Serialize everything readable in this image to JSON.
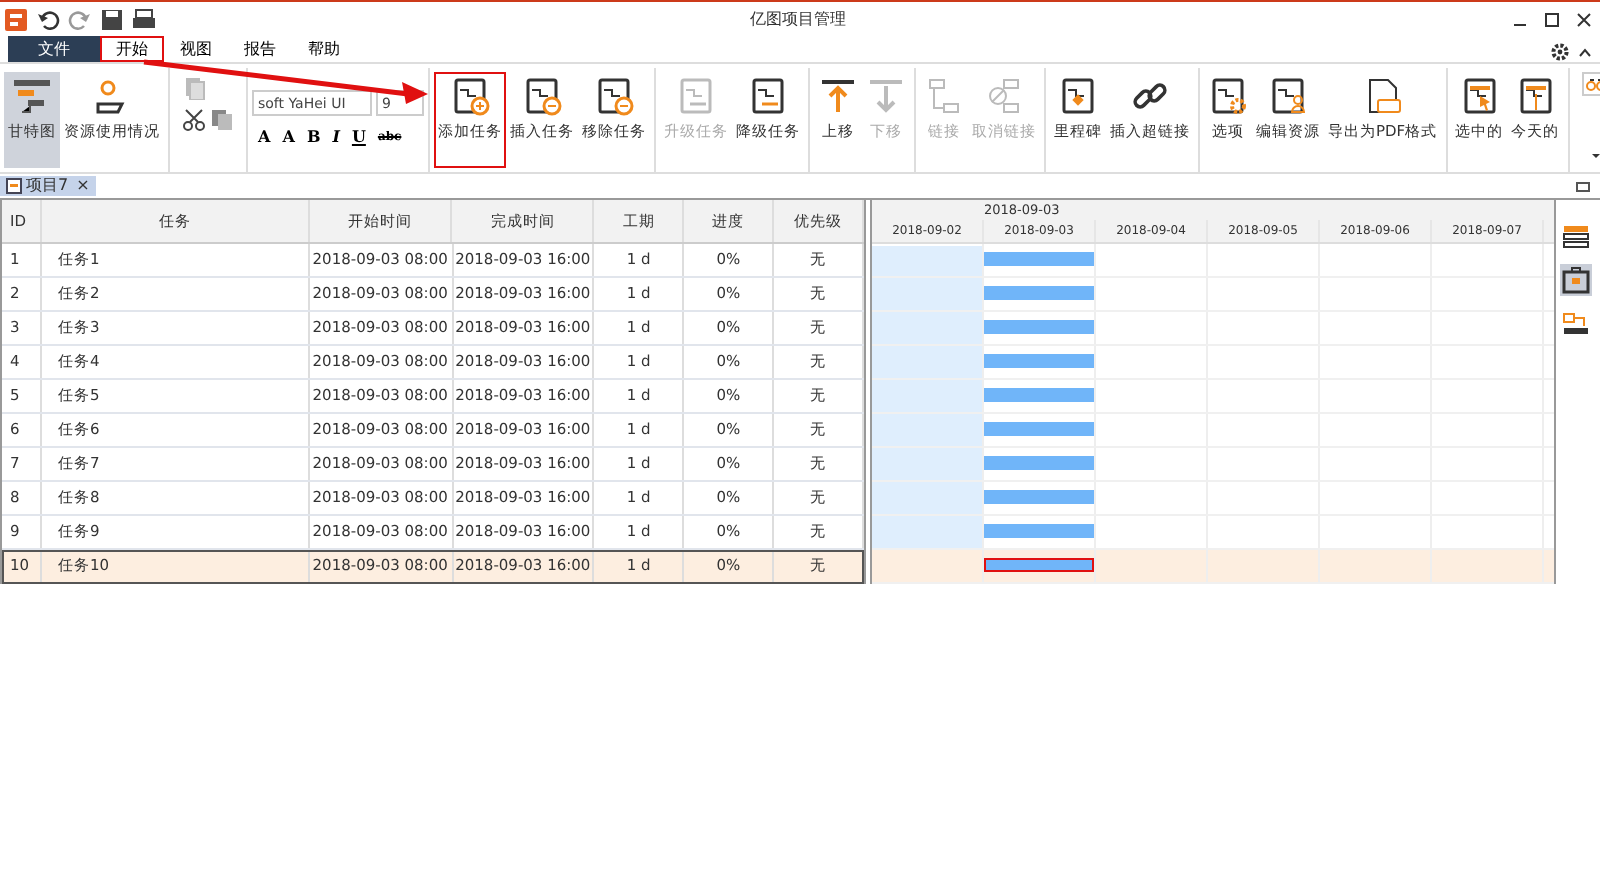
{
  "window": {
    "title": "亿图项目管理"
  },
  "menu_tabs": [
    {
      "label": "文件",
      "kind": "file",
      "selected": false,
      "highlighted": false
    },
    {
      "label": "开始",
      "kind": "tab",
      "selected": true,
      "highlighted": true
    },
    {
      "label": "视图",
      "kind": "tab",
      "selected": false,
      "highlighted": false
    },
    {
      "label": "报告",
      "kind": "tab",
      "selected": false,
      "highlighted": false
    },
    {
      "label": "帮助",
      "kind": "tab",
      "selected": false,
      "highlighted": false
    }
  ],
  "ribbon": [
    {
      "kind": "buttons",
      "items": [
        {
          "label": "甘特图",
          "selected": true,
          "disabled": false,
          "highlighted": false
        },
        {
          "label": "资源使用情况",
          "selected": false,
          "disabled": false,
          "highlighted": false
        }
      ]
    },
    {
      "kind": "clipboard"
    },
    {
      "kind": "font",
      "font": "soft YaHei UI",
      "size": "9",
      "styles": [
        "A",
        "A",
        "B",
        "I",
        "U",
        "abc"
      ]
    },
    {
      "kind": "buttons",
      "items": [
        {
          "label": "添加任务",
          "selected": false,
          "disabled": false,
          "highlighted": true
        },
        {
          "label": "插入任务",
          "selected": false,
          "disabled": false,
          "highlighted": false
        },
        {
          "label": "移除任务",
          "selected": false,
          "disabled": false,
          "highlighted": false
        }
      ]
    },
    {
      "kind": "buttons",
      "items": [
        {
          "label": "升级任务",
          "selected": false,
          "disabled": true,
          "highlighted": false
        },
        {
          "label": "降级任务",
          "selected": false,
          "disabled": false,
          "highlighted": false
        }
      ]
    },
    {
      "kind": "buttons",
      "items": [
        {
          "label": "上移",
          "selected": false,
          "disabled": false,
          "highlighted": false
        },
        {
          "label": "下移",
          "selected": false,
          "disabled": true,
          "highlighted": false
        }
      ]
    },
    {
      "kind": "buttons",
      "items": [
        {
          "label": "链接",
          "selected": false,
          "disabled": true,
          "highlighted": false
        },
        {
          "label": "取消链接",
          "selected": false,
          "disabled": true,
          "highlighted": false
        }
      ]
    },
    {
      "kind": "buttons",
      "items": [
        {
          "label": "里程碑",
          "selected": false,
          "disabled": false,
          "highlighted": false
        },
        {
          "label": "插入超链接",
          "selected": false,
          "disabled": false,
          "highlighted": false
        }
      ]
    },
    {
      "kind": "buttons",
      "items": [
        {
          "label": "选项",
          "selected": false,
          "disabled": false,
          "highlighted": false
        },
        {
          "label": "编辑资源",
          "selected": false,
          "disabled": false,
          "highlighted": false
        },
        {
          "label": "导出为PDF格式",
          "selected": false,
          "disabled": false,
          "highlighted": false
        }
      ]
    },
    {
      "kind": "buttons",
      "items": [
        {
          "label": "选中的",
          "selected": false,
          "disabled": false,
          "highlighted": false
        },
        {
          "label": "今天的",
          "selected": false,
          "disabled": false,
          "highlighted": false
        }
      ]
    },
    {
      "kind": "more"
    }
  ],
  "document_tab": {
    "label": "项目7",
    "close": "×"
  },
  "table": {
    "columns": [
      "ID",
      "任务",
      "开始时间",
      "完成时间",
      "工期",
      "进度",
      "优先级"
    ],
    "rows": [
      {
        "cells": [
          "1",
          "任务1",
          "2018-09-03 08:00",
          "2018-09-03 16:00",
          "1 d",
          "0%",
          "无"
        ],
        "selected": false
      },
      {
        "cells": [
          "2",
          "任务2",
          "2018-09-03 08:00",
          "2018-09-03 16:00",
          "1 d",
          "0%",
          "无"
        ],
        "selected": false
      },
      {
        "cells": [
          "3",
          "任务3",
          "2018-09-03 08:00",
          "2018-09-03 16:00",
          "1 d",
          "0%",
          "无"
        ],
        "selected": false
      },
      {
        "cells": [
          "4",
          "任务4",
          "2018-09-03 08:00",
          "2018-09-03 16:00",
          "1 d",
          "0%",
          "无"
        ],
        "selected": false
      },
      {
        "cells": [
          "5",
          "任务5",
          "2018-09-03 08:00",
          "2018-09-03 16:00",
          "1 d",
          "0%",
          "无"
        ],
        "selected": false
      },
      {
        "cells": [
          "6",
          "任务6",
          "2018-09-03 08:00",
          "2018-09-03 16:00",
          "1 d",
          "0%",
          "无"
        ],
        "selected": false
      },
      {
        "cells": [
          "7",
          "任务7",
          "2018-09-03 08:00",
          "2018-09-03 16:00",
          "1 d",
          "0%",
          "无"
        ],
        "selected": false
      },
      {
        "cells": [
          "8",
          "任务8",
          "2018-09-03 08:00",
          "2018-09-03 16:00",
          "1 d",
          "0%",
          "无"
        ],
        "selected": false
      },
      {
        "cells": [
          "9",
          "任务9",
          "2018-09-03 08:00",
          "2018-09-03 16:00",
          "1 d",
          "0%",
          "无"
        ],
        "selected": false
      },
      {
        "cells": [
          "10",
          "任务10",
          "2018-09-03 08:00",
          "2018-09-03 16:00",
          "1 d",
          "0%",
          "无"
        ],
        "selected": true
      }
    ]
  },
  "gantt": {
    "period": "2018-09-03",
    "days": [
      {
        "label": "2018-09-02",
        "nonworking": true
      },
      {
        "label": "2018-09-03",
        "nonworking": false
      },
      {
        "label": "2018-09-04",
        "nonworking": false
      },
      {
        "label": "2018-09-05",
        "nonworking": false
      },
      {
        "label": "2018-09-06",
        "nonworking": false
      },
      {
        "label": "2018-09-07",
        "nonworking": false
      }
    ]
  }
}
